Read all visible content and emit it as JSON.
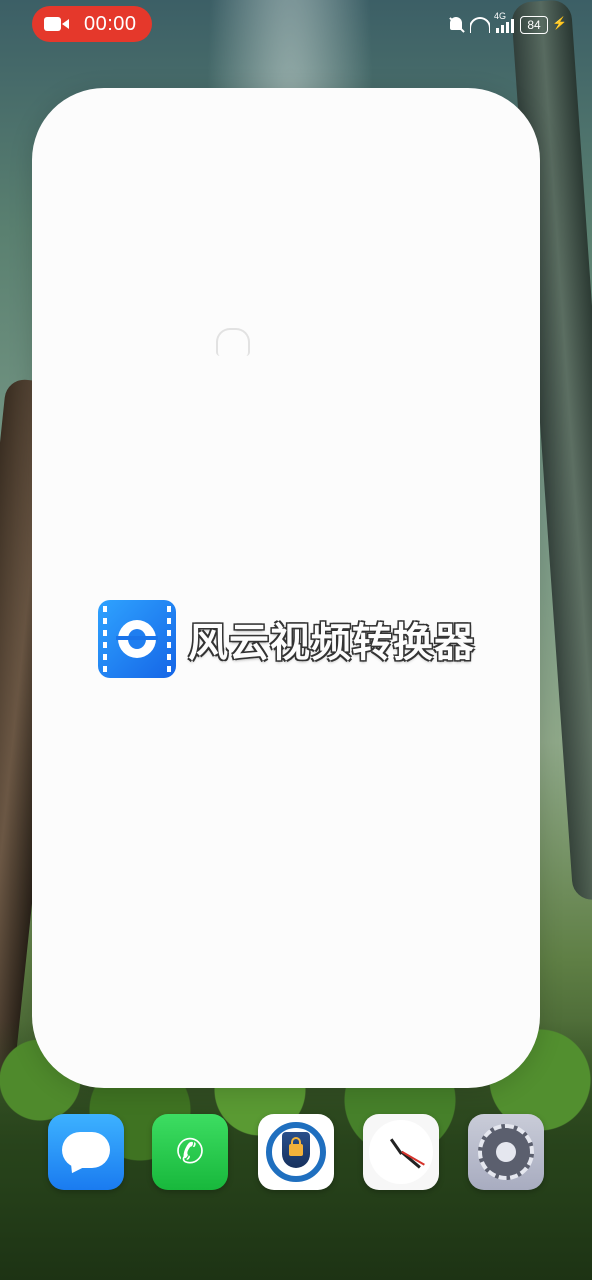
{
  "status_bar": {
    "recording_time": "00:00",
    "network_type": "4G",
    "battery_level": "84",
    "icons": [
      "video-camera-icon",
      "mute-bell-icon",
      "wifi-icon",
      "signal-icon",
      "battery-icon",
      "charging-bolt-icon"
    ]
  },
  "splash": {
    "app_name": "风云视频转换器",
    "app_icon": "video-converter-app-icon",
    "background": "#fcfcfc"
  },
  "dock": {
    "apps": [
      {
        "name": "messages",
        "icon": "messages-app-icon",
        "color": "#2a96ff"
      },
      {
        "name": "phone",
        "icon": "phone-app-icon",
        "color": "#2acb4e"
      },
      {
        "name": "vault",
        "icon": "vault-app-icon",
        "color": "#1f6fbf"
      },
      {
        "name": "clock",
        "icon": "clock-app-icon",
        "color": "#f7f7f7"
      },
      {
        "name": "settings",
        "icon": "settings-app-icon",
        "color": "#b8bccc"
      }
    ]
  },
  "colors": {
    "recording_pill": "#e5382b",
    "accent_blue": "#1f7ef0"
  }
}
